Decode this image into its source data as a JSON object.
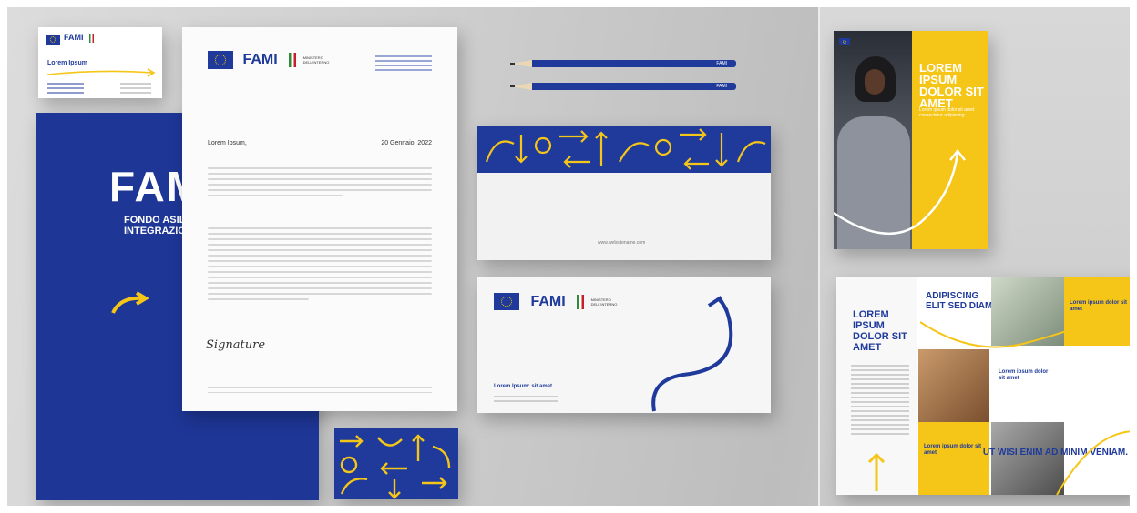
{
  "scene": {
    "accent_blue": "#1e3696",
    "accent_yellow": "#f5c518"
  },
  "business_card": {
    "brand": "FAMI",
    "name": "Lorem Ipsum"
  },
  "folder": {
    "logo": "FAMI",
    "subtitle_line1": "FONDO ASILO M",
    "subtitle_line2": "INTEGRAZIONE"
  },
  "letterhead": {
    "brand": "FAMI",
    "ministry_line1": "MINISTERO",
    "ministry_line2": "DELL'INTERNO",
    "salutation": "Lorem Ipsum,",
    "date": "20 Gennaio, 2022",
    "signature": "Signature"
  },
  "pencils": {
    "label": "FAMI"
  },
  "envelope_back": {
    "url": "www.websitename.com"
  },
  "envelope_front": {
    "brand": "FAMI",
    "ministry_line1": "MINISTERO",
    "ministry_line2": "DELL'INTERNO",
    "address_title": "Lorem Ipsum: sit amet"
  },
  "flyer": {
    "title": "LOREM IPSUM DOLOR SIT AMET",
    "subtitle": "Lorem ipsum dolor sit amet consectetur adipiscing"
  },
  "brochure": {
    "left_title": "LOREM IPSUM DOLOR SIT AMET",
    "mid_title": "ADIPISCING ELIT SED DIAM.",
    "box1": "Lorem ipsum dolor sit amet",
    "box2": "Lorem ipsum dolor sit amet",
    "box3": "Lorem ipsum dolor sit amet",
    "closing": "UT WISI ENIM AD MINIM VENIAM."
  }
}
